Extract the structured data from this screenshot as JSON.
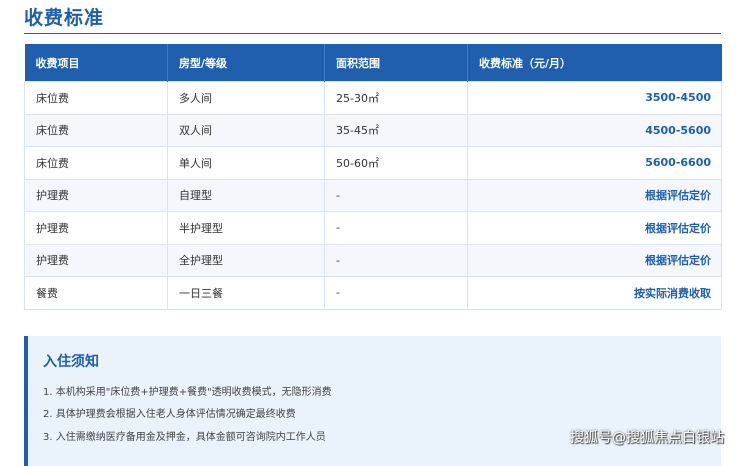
{
  "section_title": "收费标准",
  "table": {
    "headers": [
      "收费项目",
      "房型/等级",
      "面积范围",
      "收费标准（元/月）"
    ],
    "rows": [
      [
        "床位费",
        "多人间",
        "25-30㎡",
        "3500-4500"
      ],
      [
        "床位费",
        "双人间",
        "35-45㎡",
        "4500-5600"
      ],
      [
        "床位费",
        "单人间",
        "50-60㎡",
        "5600-6600"
      ],
      [
        "护理费",
        "自理型",
        "-",
        "根据评估定价"
      ],
      [
        "护理费",
        "半护理型",
        "-",
        "根据评估定价"
      ],
      [
        "护理费",
        "全护理型",
        "-",
        "根据评估定价"
      ],
      [
        "餐费",
        "一日三餐",
        "-",
        "按实际消费收取"
      ]
    ]
  },
  "notice": {
    "title": "入住须知",
    "items": [
      "1. 本机构采用\"床位费+护理费+餐费\"透明收费模式，无隐形消费",
      "2. 具体护理费会根据入住老人身体评估情况确定最终收费",
      "3. 入住需缴纳医疗备用金及押金，具体金额可咨询院内工作人员"
    ]
  },
  "watermark": "搜狐号@搜狐焦点白银站"
}
